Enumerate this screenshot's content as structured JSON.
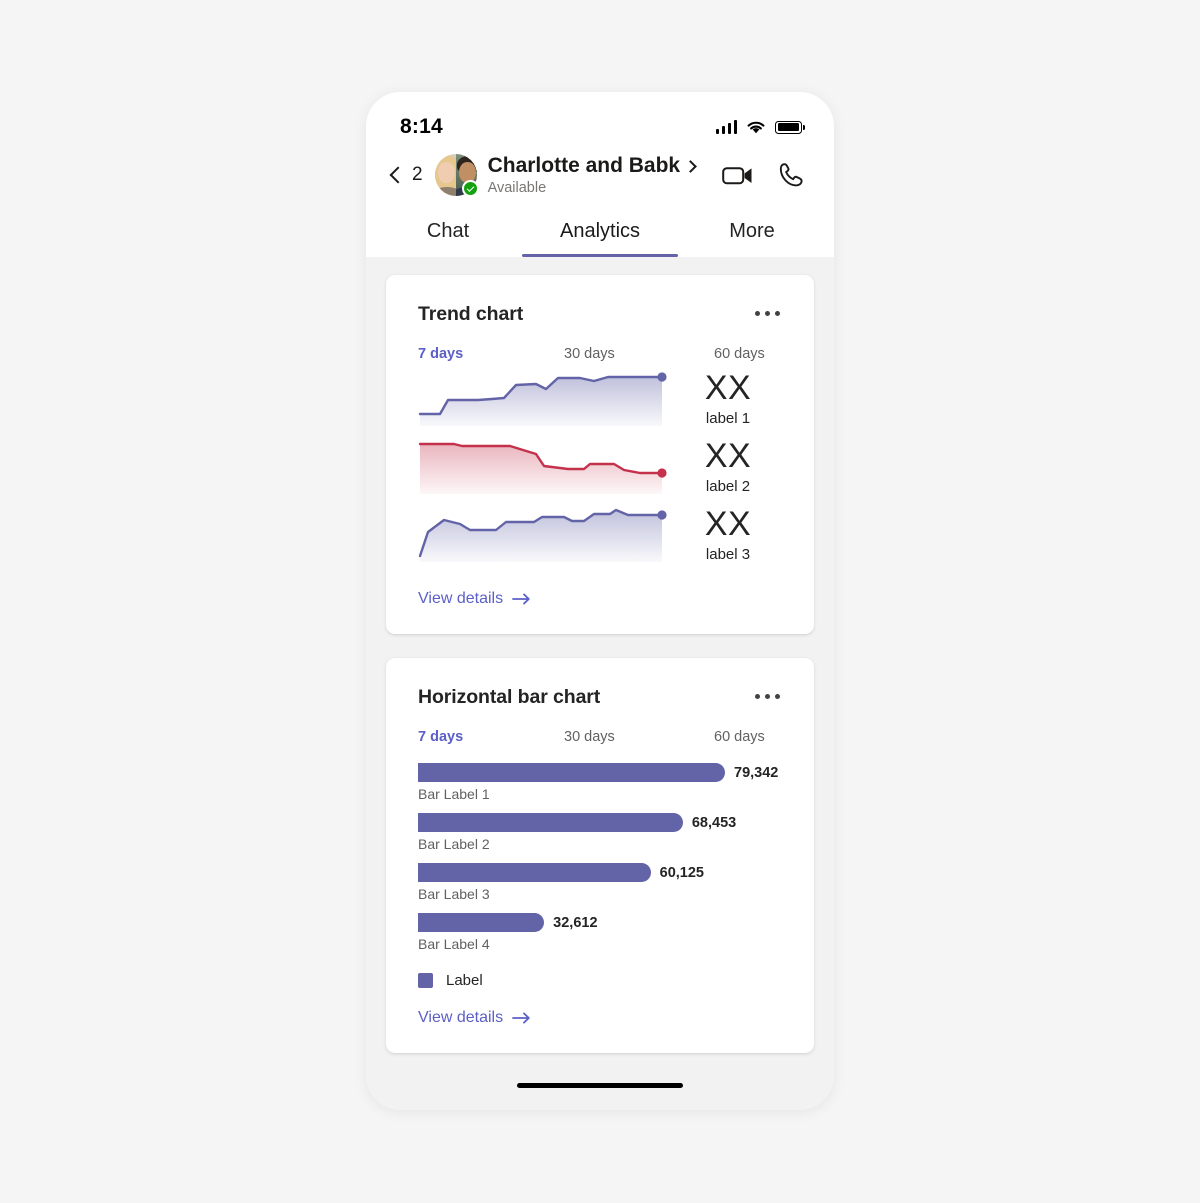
{
  "status_bar": {
    "time": "8:14",
    "signal_icon": "cellular-signal-icon",
    "wifi_icon": "wifi-icon",
    "battery_icon": "battery-full-icon"
  },
  "chat_header": {
    "back_icon": "chevron-left-icon",
    "back_count": "2",
    "avatar_name": "group-avatar",
    "title": "Charlotte and Babk",
    "title_chevron_icon": "chevron-right-icon",
    "presence": "Available",
    "presence_icon": "available-check-icon",
    "video_call_icon": "video-camera-icon",
    "audio_call_icon": "phone-icon"
  },
  "tabs": [
    {
      "label": "Chat",
      "active": false
    },
    {
      "label": "Analytics",
      "active": true
    },
    {
      "label": "More",
      "active": false
    }
  ],
  "colors": {
    "accent": "#6264a7",
    "link": "#5b5fc7",
    "trend_up": "#6264a7",
    "trend_down": "#c4314b",
    "presence_available": "#13a10e"
  },
  "cards": [
    {
      "title": "Trend chart",
      "overflow_icon": "more-options-icon",
      "ranges": [
        {
          "label": "7 days",
          "active": true
        },
        {
          "label": "30 days",
          "active": false
        },
        {
          "label": "60 days",
          "active": false
        }
      ],
      "rows": [
        {
          "value": "XX",
          "label": "label 1"
        },
        {
          "value": "XX",
          "label": "label 2"
        },
        {
          "value": "XX",
          "label": "label 3"
        }
      ],
      "view_details": "View details",
      "view_details_icon": "arrow-right-icon"
    },
    {
      "title": "Horizontal bar chart",
      "overflow_icon": "more-options-icon",
      "ranges": [
        {
          "label": "7 days",
          "active": true
        },
        {
          "label": "30 days",
          "active": false
        },
        {
          "label": "60 days",
          "active": false
        }
      ],
      "legend_label": "Label",
      "view_details": "View details",
      "view_details_icon": "arrow-right-icon"
    }
  ],
  "chart_data": [
    {
      "type": "area",
      "title": "Trend chart",
      "subtitle": "7 days",
      "xlabel": "",
      "ylabel": "",
      "grid": false,
      "legend": "none",
      "x": [
        0,
        1,
        2,
        3,
        4,
        5,
        6,
        7,
        8,
        9,
        10,
        11,
        12,
        13,
        14,
        15,
        16
      ],
      "series": [
        {
          "name": "label 1",
          "display_value": "XX",
          "color": "#6264a7",
          "fill": "gradient-purple",
          "end_marker": true,
          "values": [
            22,
            22,
            22,
            40,
            40,
            40,
            40,
            41,
            63,
            64,
            64,
            57,
            72,
            74,
            72,
            75,
            76
          ],
          "ylim": [
            0,
            100
          ]
        },
        {
          "name": "label 2",
          "display_value": "XX",
          "color": "#c4314b",
          "fill": "gradient-red",
          "end_marker": true,
          "values": [
            88,
            88,
            87,
            86,
            86,
            85,
            82,
            80,
            62,
            60,
            60,
            65,
            64,
            62,
            59,
            49,
            48
          ],
          "ylim": [
            0,
            100
          ]
        },
        {
          "name": "label 3",
          "display_value": "XX",
          "color": "#6264a7",
          "fill": "gradient-purple",
          "end_marker": true,
          "values": [
            8,
            48,
            63,
            60,
            52,
            52,
            52,
            61,
            60,
            60,
            67,
            68,
            66,
            66,
            78,
            84,
            76,
            76,
            78
          ],
          "ylim": [
            0,
            100
          ]
        }
      ]
    },
    {
      "type": "bar",
      "orientation": "horizontal",
      "title": "Horizontal bar chart",
      "subtitle": "7 days",
      "xlabel": "",
      "ylabel": "",
      "grid": false,
      "legend": "bottom-left",
      "legend_entries": [
        "Label"
      ],
      "series_color": "#6264a7",
      "categories": [
        "Bar Label 1",
        "Bar Label 2",
        "Bar Label 3",
        "Bar Label 4"
      ],
      "values": [
        79342,
        68453,
        60125,
        32612
      ],
      "value_labels": [
        "79,342",
        "68,453",
        "60,125",
        "32,612"
      ],
      "xlim": [
        0,
        79342
      ]
    }
  ]
}
